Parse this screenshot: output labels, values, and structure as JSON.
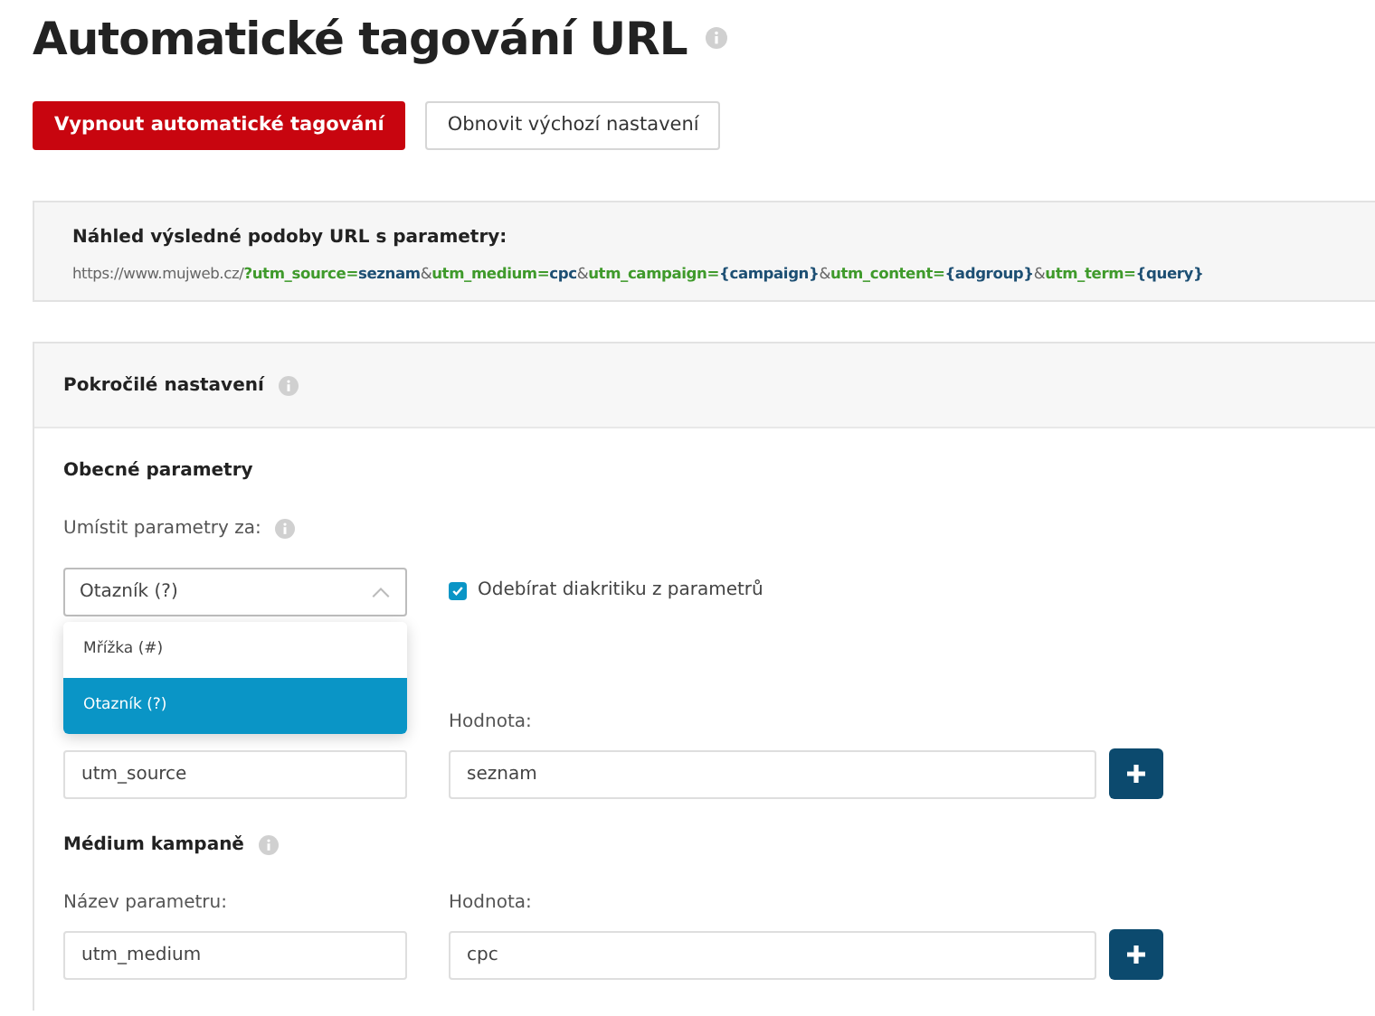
{
  "title": "Automatické tagování URL",
  "buttons": [
    {
      "label": "Vypnout automatické tagování",
      "kind": "primary"
    },
    {
      "label": "Obnovit výchozí nastavení",
      "kind": "secondary"
    }
  ],
  "preview": {
    "heading": "Náhled výsledné podoby URL s parametry:",
    "segments": [
      {
        "text": "https://www.mujweb.cz/",
        "kind": "plain"
      },
      {
        "text": "?utm_source=",
        "kind": "key"
      },
      {
        "text": "seznam",
        "kind": "value"
      },
      {
        "text": "&",
        "kind": "plain"
      },
      {
        "text": "utm_medium=",
        "kind": "key"
      },
      {
        "text": "cpc",
        "kind": "value"
      },
      {
        "text": "&",
        "kind": "plain"
      },
      {
        "text": "utm_campaign=",
        "kind": "key"
      },
      {
        "text": "{campaign}",
        "kind": "value"
      },
      {
        "text": "&",
        "kind": "plain"
      },
      {
        "text": "utm_content=",
        "kind": "key"
      },
      {
        "text": "{adgroup}",
        "kind": "value"
      },
      {
        "text": "&",
        "kind": "plain"
      },
      {
        "text": "utm_term=",
        "kind": "key"
      },
      {
        "text": "{query}",
        "kind": "value"
      }
    ]
  },
  "advanced": {
    "title": "Pokročilé nastavení",
    "section_title": "Obecné parametry",
    "placement_label": "Umístit parametry za:",
    "placement_select": {
      "value": "Otazník (?)",
      "expanded": true,
      "options": [
        {
          "label": "Mřížka (#)",
          "selected": false
        },
        {
          "label": "Otazník (?)",
          "selected": true
        }
      ]
    },
    "diacritics": {
      "label": "Odebírat diakritiku z parametrů",
      "checked": true
    },
    "param_groups": [
      {
        "name_value": "utm_source",
        "value_label": "Hodnota:",
        "value": "seznam"
      },
      {
        "heading": "Médium kampaně",
        "name_label": "Název parametru:",
        "name_value": "utm_medium",
        "value_label": "Hodnota:",
        "value": "cpc"
      }
    ]
  }
}
